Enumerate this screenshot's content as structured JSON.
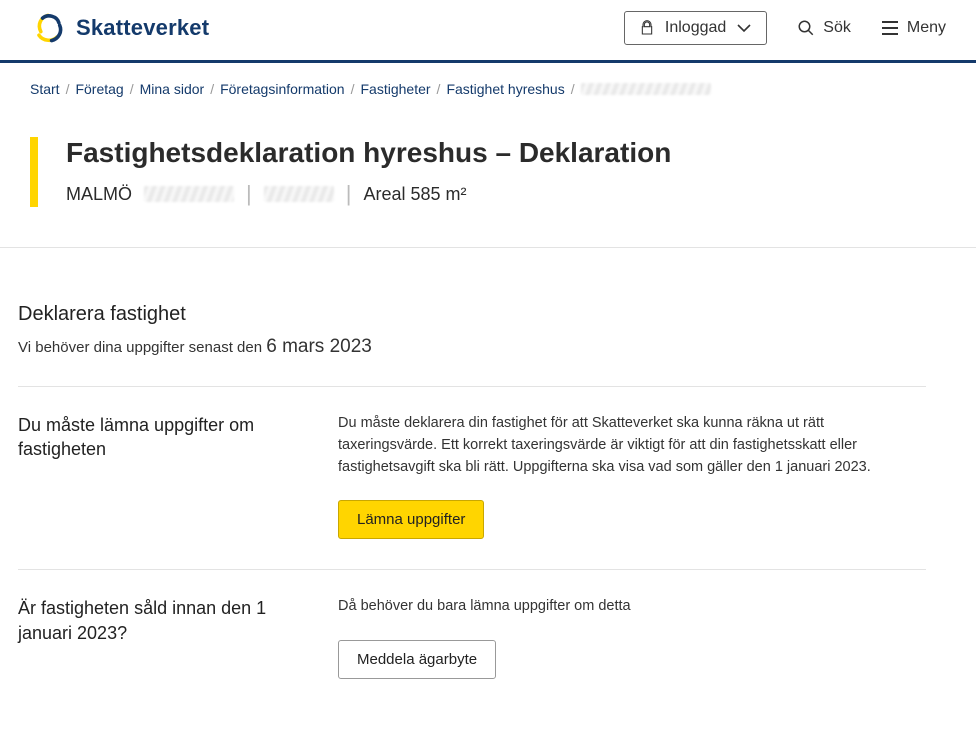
{
  "header": {
    "brand": "Skatteverket",
    "login_label": "Inloggad",
    "search_label": "Sök",
    "menu_label": "Meny"
  },
  "breadcrumb": {
    "items": [
      "Start",
      "Företag",
      "Mina sidor",
      "Företagsinformation",
      "Fastigheter",
      "Fastighet hyreshus"
    ]
  },
  "title": {
    "heading": "Fastighetsdeklaration hyreshus – Deklaration",
    "city": "MALMÖ",
    "area_label": "Areal 585 m²"
  },
  "deadline": {
    "heading": "Deklarera fastighet",
    "prefix": "Vi behöver dina uppgifter senast den ",
    "date": "6 mars 2023"
  },
  "row1": {
    "heading": "Du måste lämna uppgifter om fastigheten",
    "body": "Du måste deklarera din fastighet för att Skatteverket ska kunna räkna ut rätt taxeringsvärde. Ett korrekt taxeringsvärde är viktigt för att din fastighetsskatt eller fastighetsavgift ska bli rätt. Uppgifterna ska visa vad som gäller den 1 januari 2023.",
    "button": "Lämna uppgifter"
  },
  "row2": {
    "heading": "Är fastigheten såld innan den 1 januari 2023?",
    "body": "Då behöver du bara lämna uppgifter om detta",
    "button": "Meddela ägarbyte"
  }
}
